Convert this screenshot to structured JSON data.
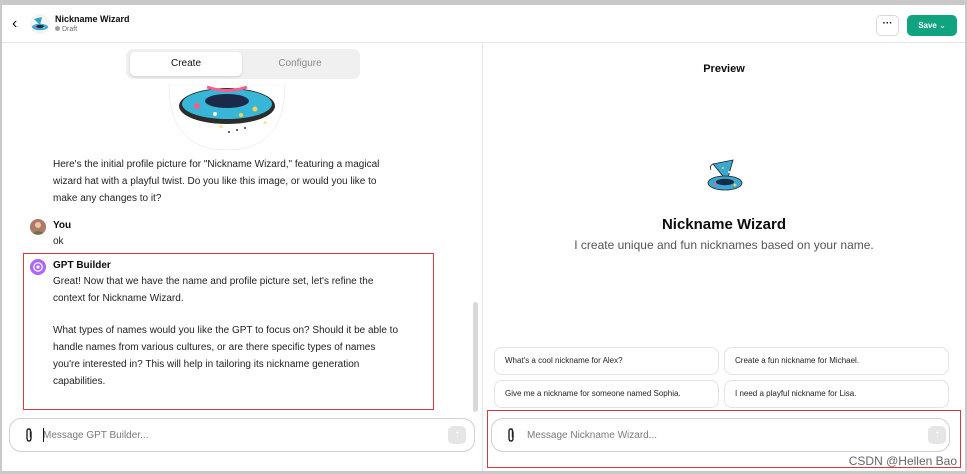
{
  "header": {
    "title": "Nickname Wizard",
    "status": "Draft",
    "more_label": "···",
    "save_label": "Save ⌄"
  },
  "tabs": [
    {
      "label": "Create",
      "active": true
    },
    {
      "label": "Configure",
      "active": false
    }
  ],
  "chat": {
    "intro_message": "Here's the initial profile picture for \"Nickname Wizard,\" featuring a magical wizard hat with a playful twist. Do you like this image, or would you like to make any changes to it?",
    "user_name": "You",
    "user_message": "ok",
    "builder_name": "GPT Builder",
    "builder_message_1": "Great! Now that we have the name and profile picture set, let's refine the context for Nickname Wizard.",
    "builder_message_2": "What types of names would you like the GPT to focus on? Should it be able to handle names from various cultures, or are there specific types of names you're interested in? This will help in tailoring its nickname generation capabilities.",
    "input_placeholder": "Message GPT Builder..."
  },
  "preview": {
    "title": "Preview",
    "gpt_name": "Nickname Wizard",
    "gpt_description": "I create unique and fun nicknames based on your name.",
    "suggestions": [
      "What's a cool nickname for Alex?",
      "Create a fun nickname for Michael.",
      "Give me a nickname for someone named Sophia.",
      "I need a playful nickname for Lisa."
    ],
    "input_placeholder": "Message Nickname Wizard..."
  },
  "colors": {
    "accent": "#10a37f",
    "highlight": "#d9383f",
    "builder_avatar": "#ab68ff"
  },
  "watermark": "CSDN @Hellen Bao"
}
